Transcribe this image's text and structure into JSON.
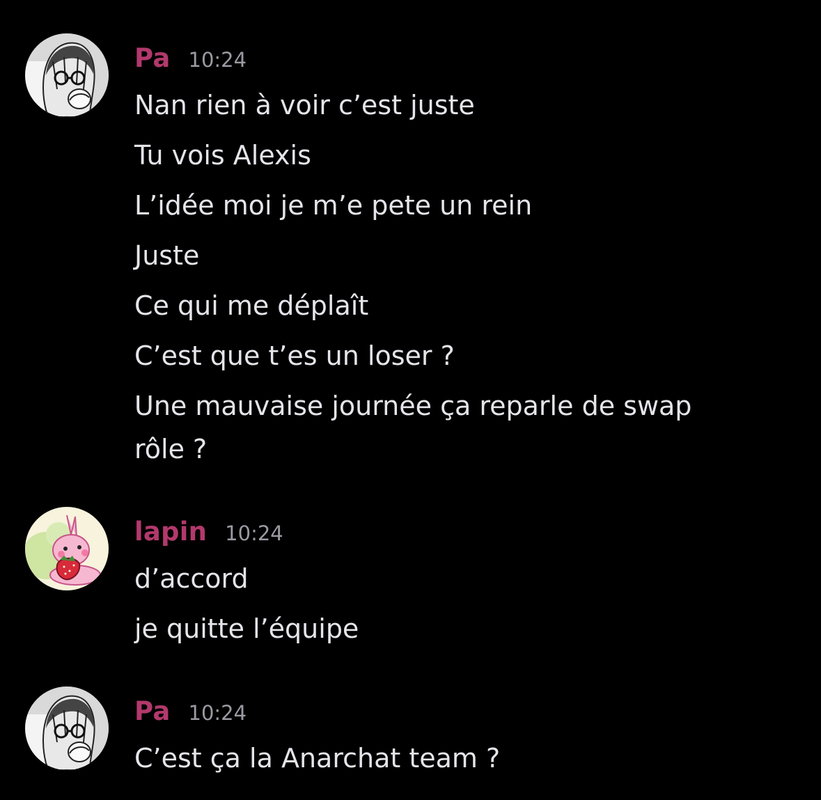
{
  "colors": {
    "background": "#000000",
    "username": "#b2396c",
    "timestamp": "#9a9aa2",
    "message_text": "#e4e4ea"
  },
  "messages": [
    {
      "author": "Pa",
      "avatar_icon": "manga-avatar-icon",
      "time": "10:24",
      "lines": [
        "Nan rien à voir c’est juste",
        "Tu vois Alexis",
        "L’idée moi je m’e pete un rein",
        "Juste",
        "Ce qui me déplaît",
        "C’est que t’es un loser ?",
        "Une mauvaise journée ça reparle de swap rôle ?"
      ]
    },
    {
      "author": "lapin",
      "avatar_icon": "bunny-strawberry-avatar-icon",
      "time": "10:24",
      "lines": [
        "d’accord",
        "je quitte l’équipe"
      ]
    },
    {
      "author": "Pa",
      "avatar_icon": "manga-avatar-icon",
      "time": "10:24",
      "lines": [
        "C’est ça la Anarchat team ?"
      ]
    }
  ]
}
